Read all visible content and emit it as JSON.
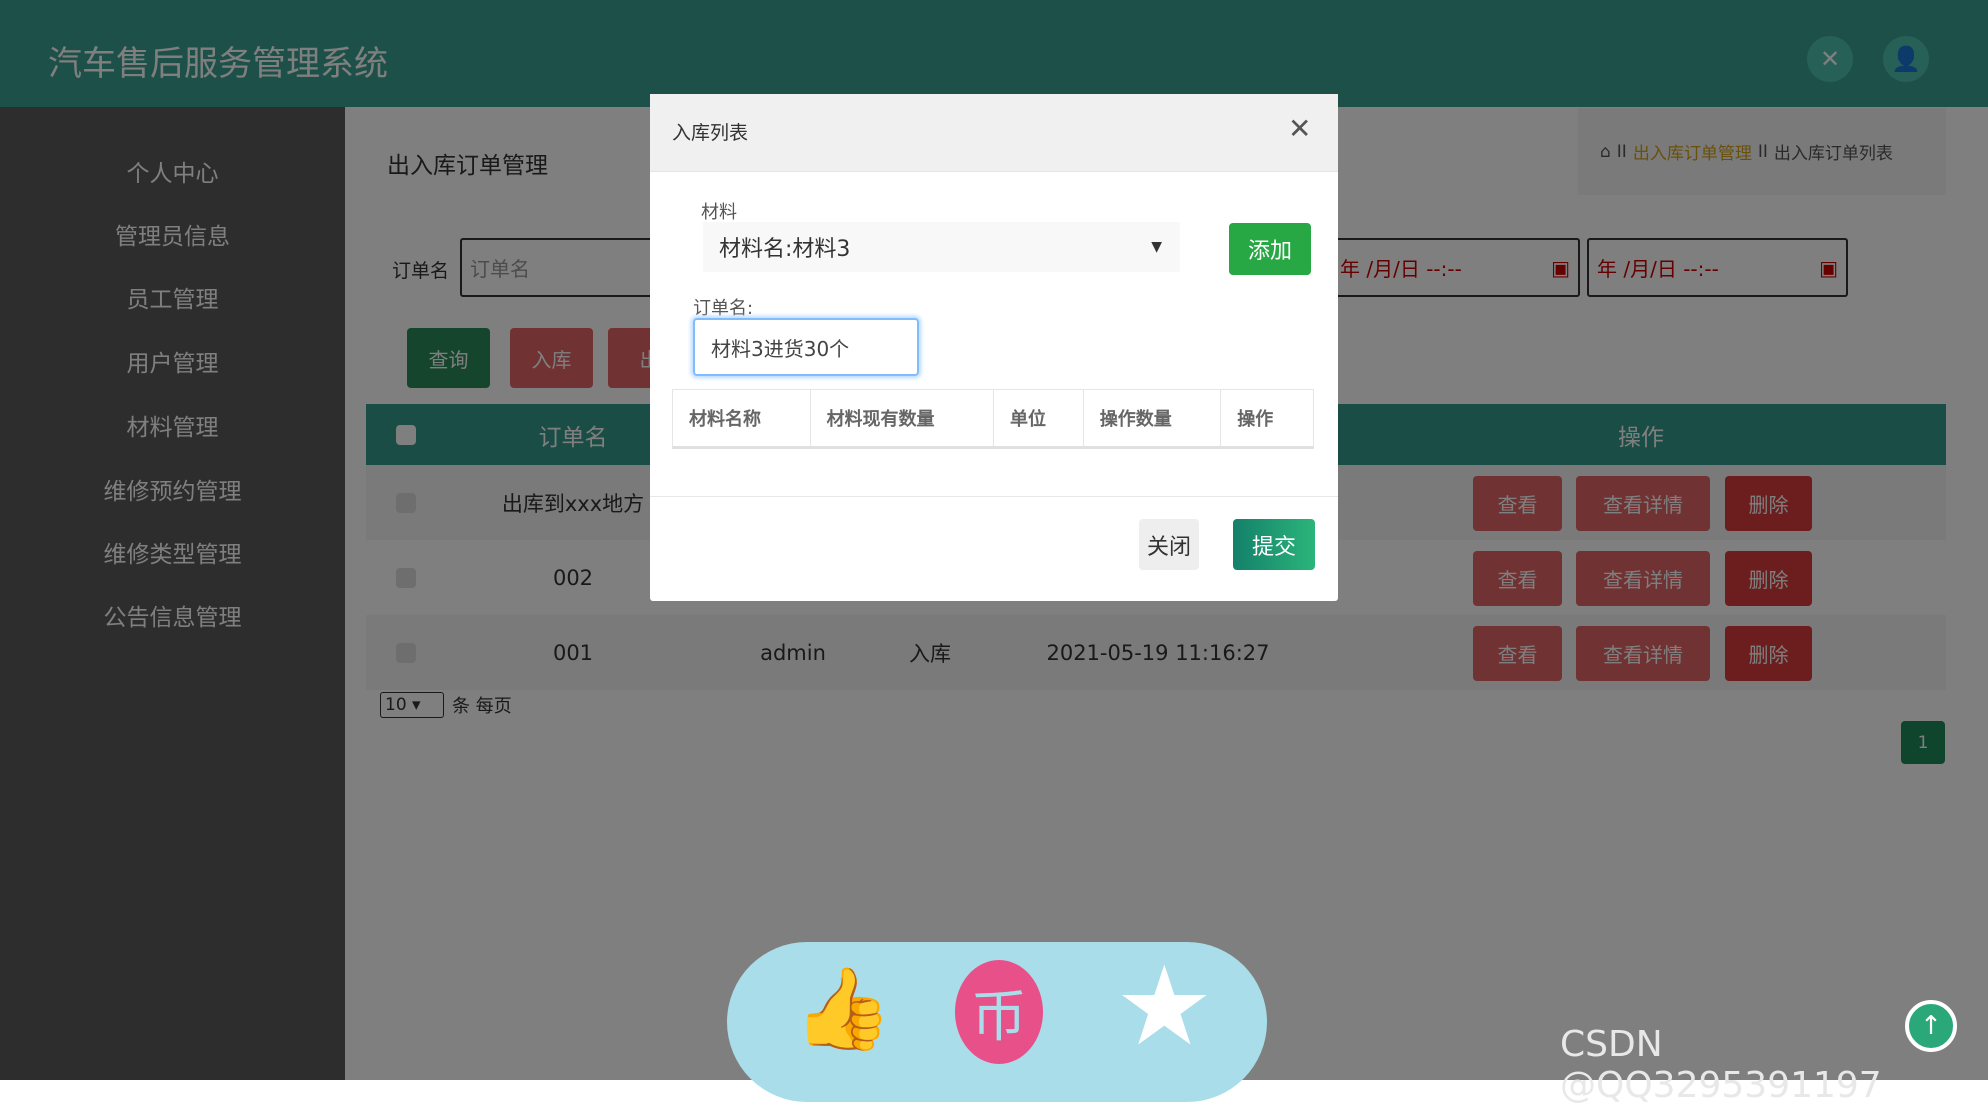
{
  "header": {
    "title": "汽车售后服务管理系统",
    "icons": [
      "fullscreen-icon",
      "user-icon"
    ]
  },
  "sidebar": {
    "items": [
      {
        "label": "个人中心"
      },
      {
        "label": "管理员信息"
      },
      {
        "label": "员工管理"
      },
      {
        "label": "用户管理"
      },
      {
        "label": "材料管理"
      },
      {
        "label": "维修预约管理"
      },
      {
        "label": "维修类型管理"
      },
      {
        "label": "公告信息管理"
      }
    ]
  },
  "main": {
    "title": "出入库订单管理",
    "breadcrumb": {
      "sep": "II",
      "link": "出入库订单管理",
      "current": "出入库订单列表"
    },
    "search": {
      "label": "订单名",
      "placeholder": "订单名",
      "date_placeholder": "年 /月/日 --:--"
    },
    "buttons": {
      "query": "查询",
      "in": "入库",
      "out": "出"
    },
    "table": {
      "headers": {
        "name": "订单名",
        "actions": "操作"
      },
      "rows": [
        {
          "name": "出库到xxx地方",
          "user": "",
          "type": "",
          "time": ""
        },
        {
          "name": "002",
          "user": "",
          "type": "",
          "time": ""
        },
        {
          "name": "001",
          "user": "admin",
          "type": "入库",
          "time": "2021-05-19 11:16:27"
        }
      ],
      "row_actions": {
        "view": "查看",
        "detail": "查看详情",
        "delete": "删除"
      }
    },
    "pagination": {
      "page_size": "10",
      "per_page_label": "条 每页",
      "current_page": "1"
    }
  },
  "modal": {
    "title": "入库列表",
    "material_label": "材料",
    "material_value": "材料名:材料3",
    "add_button": "添加",
    "order_label": "订单名:",
    "order_value": "材料3进货30个",
    "table_headers": [
      "材料名称",
      "材料现有数量",
      "单位",
      "操作数量",
      "操作"
    ],
    "close_button": "关闭",
    "submit_button": "提交"
  },
  "watermark": "CSDN @QQ3295391197",
  "colors": {
    "header": "#3aa090",
    "accent_green": "#28a745",
    "danger": "#d93a3a",
    "bottom_bar": "#a8dde9",
    "pink": "#e8508a"
  }
}
